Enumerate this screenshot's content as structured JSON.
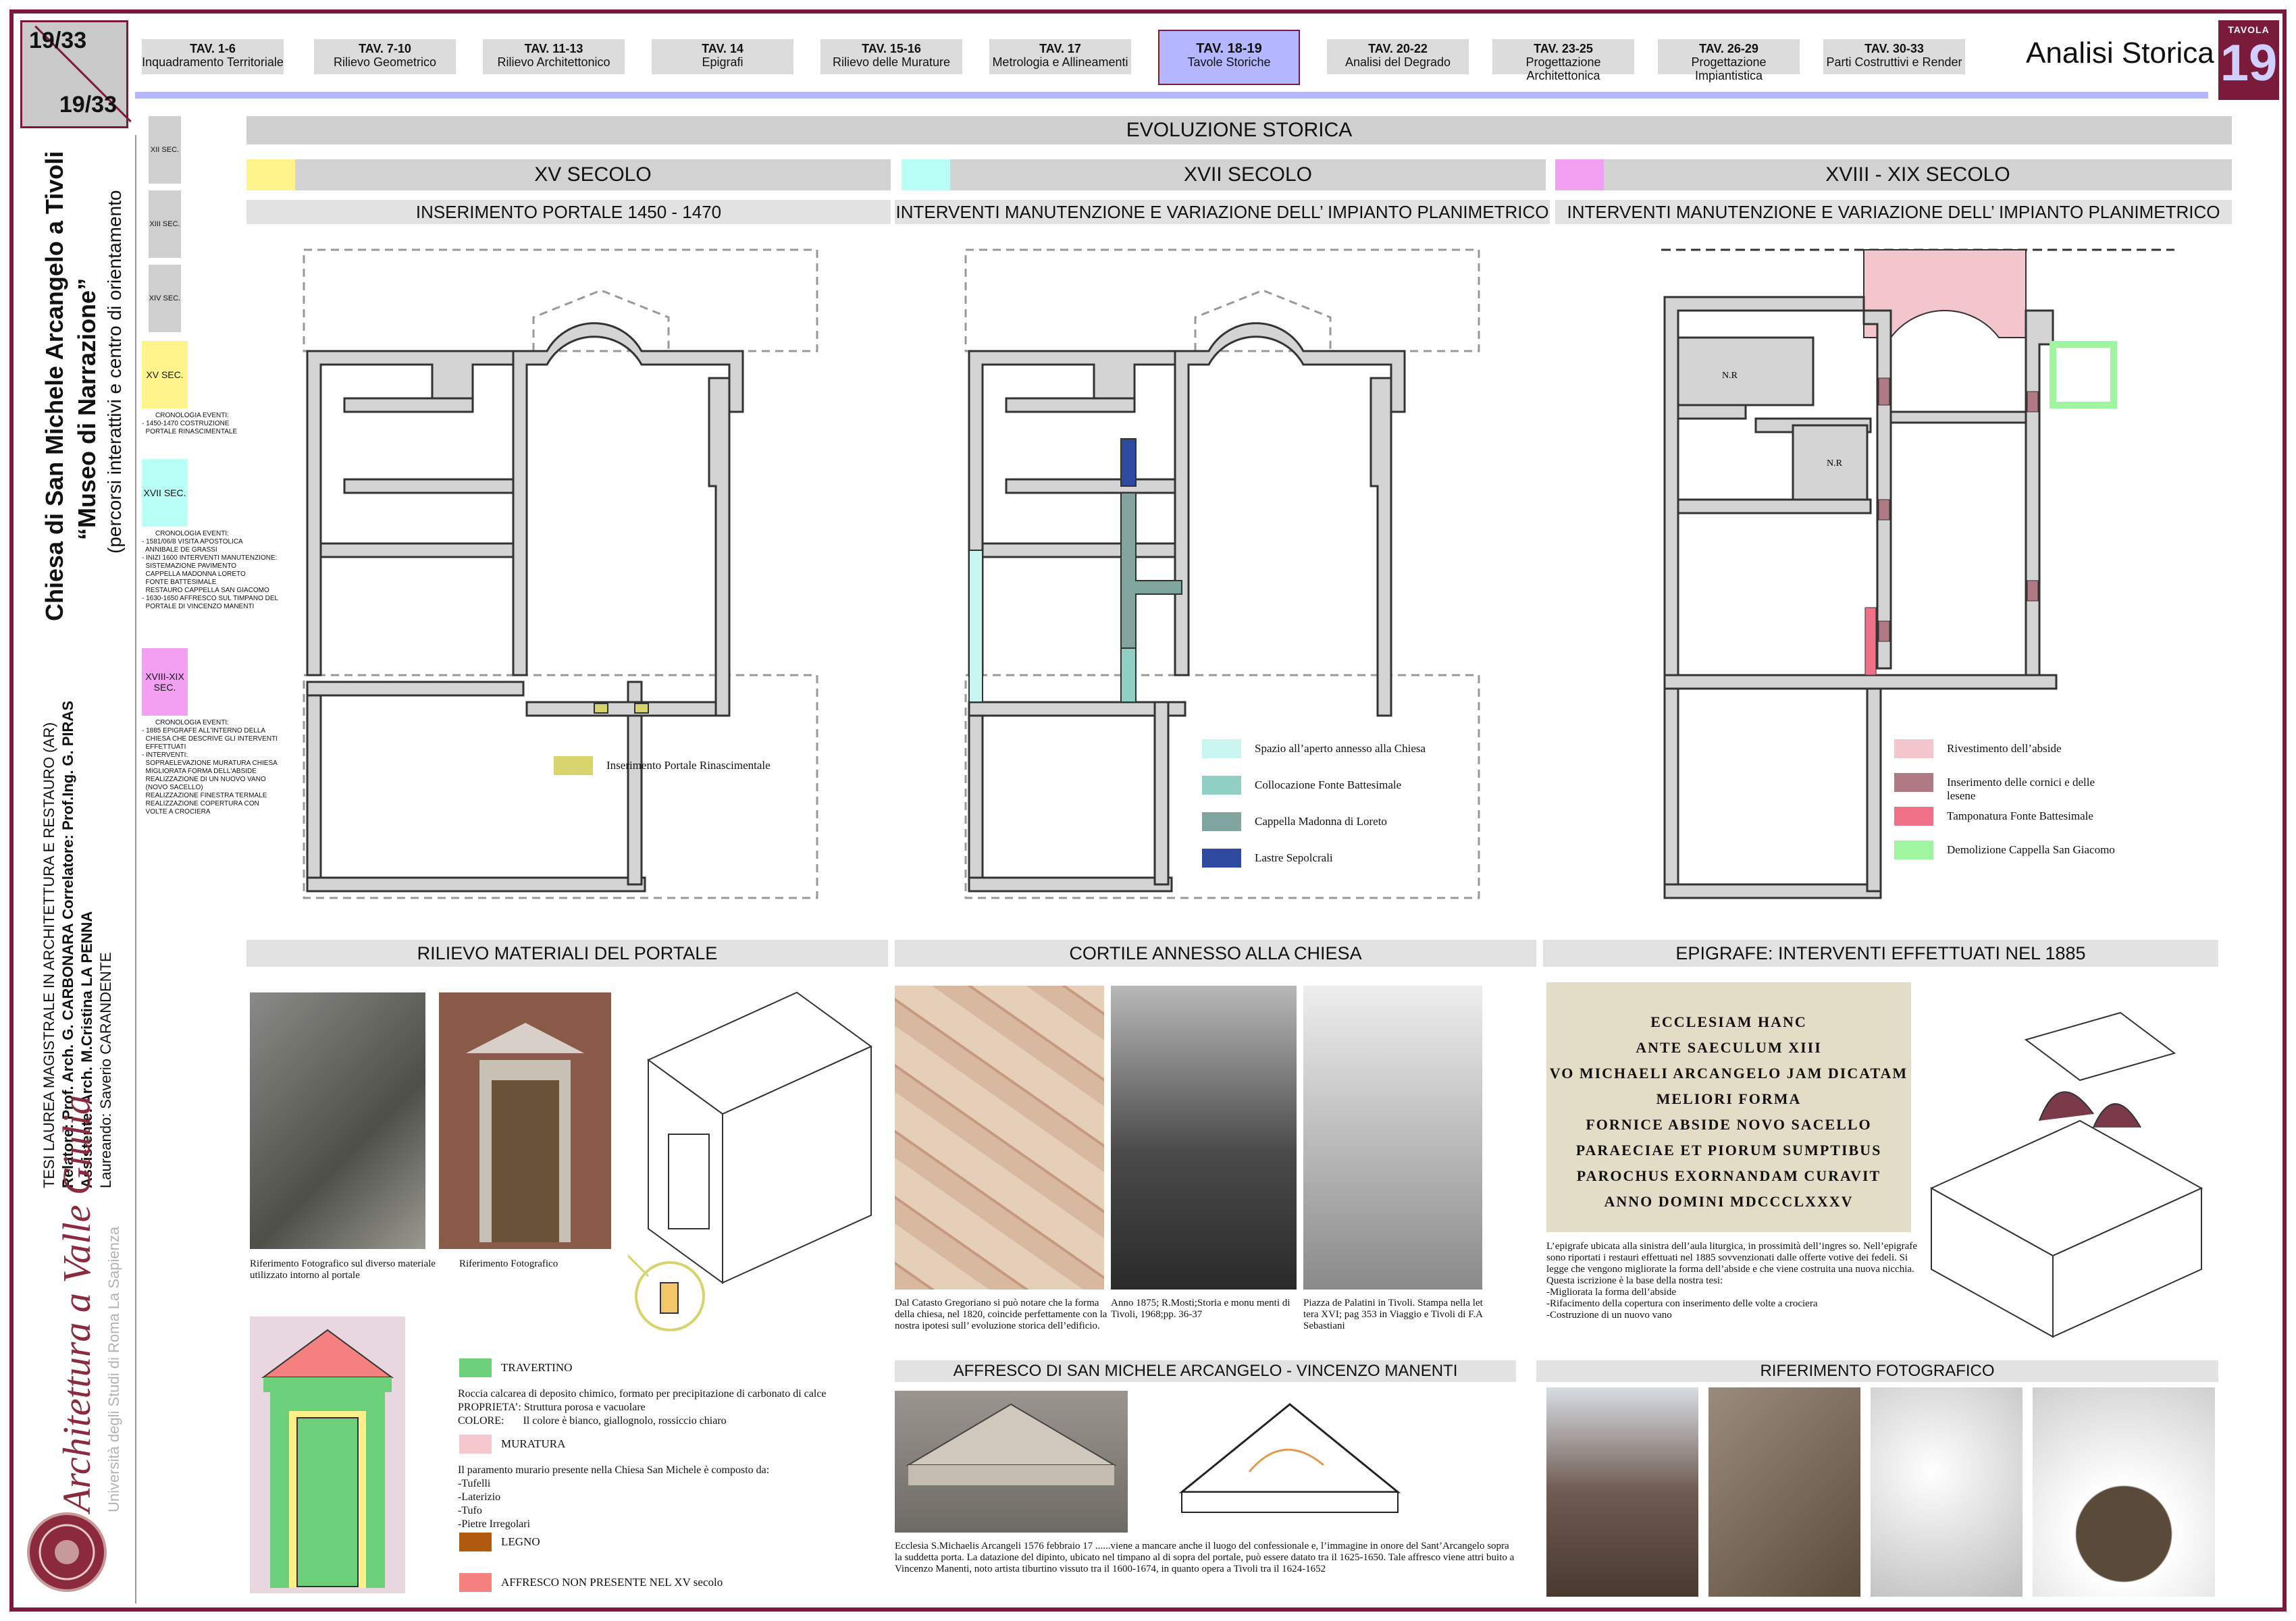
{
  "page_counter": {
    "top": "19",
    "top_total": "33",
    "bottom": "19",
    "bottom_total": "33"
  },
  "nav": {
    "tabs": [
      {
        "num": "TAV. 1-6",
        "label": "Inquadramento Territoriale"
      },
      {
        "num": "TAV. 7-10",
        "label": "Rilievo Geometrico"
      },
      {
        "num": "TAV. 11-13",
        "label": "Rilievo Architettonico"
      },
      {
        "num": "TAV. 14",
        "label": "Epigrafi"
      },
      {
        "num": "TAV. 15-16",
        "label": "Rilievo delle Murature"
      },
      {
        "num": "TAV. 17",
        "label": "Metrologia e Allineamenti"
      },
      {
        "num": "TAV. 18-19",
        "label": "Tavole Storiche",
        "active": true
      },
      {
        "num": "TAV. 20-22",
        "label": "Analisi del Degrado"
      },
      {
        "num": "TAV. 23-25",
        "label": "Progettazione Architettonica"
      },
      {
        "num": "TAV. 26-29",
        "label": "Progettazione Impiantistica"
      },
      {
        "num": "TAV. 30-33",
        "label": "Parti Costruttivi e Render"
      }
    ],
    "section_name": "Analisi Storica",
    "tavola_label": "TAVOLA",
    "tavola_number": "19"
  },
  "sidebar": {
    "title_line1": "Chiesa di San Michele Arcangelo a Tivoli",
    "title_line2": "“Museo di Narrazione”",
    "title_line3": "(percorsi interattivi e centro di orientamento",
    "thesis": "TESI LAUREA MAGISTRALE IN ARCHITETTURA E RESTAURO (AR)",
    "relatore": "Relatore: Prof. Arch. G. CARBONARA  Correlatore: Prof.Ing. G. PIRAS",
    "assistente": "Assistente: Arch. M.Cristina LA PENNA",
    "laureando": "Laureando: Saverio CARANDENTE",
    "logo_text": "Architettura a Valle Giulia",
    "university": "Università degli Studi di Roma La Sapienza",
    "seal_text": "SIBRA STUDIVM"
  },
  "timeline": {
    "centuries_grey": [
      "XII SEC.",
      "XIII SEC.",
      "XIV SEC."
    ],
    "colored": [
      {
        "label": "XV SEC.",
        "color": "#fff48c",
        "note_title": "CRONOLOGIA EVENTI:",
        "notes": [
          "- 1450-1470 COSTRUZIONE",
          "  PORTALE RINASCIMENTALE"
        ]
      },
      {
        "label": "XVII SEC.",
        "color": "#b8fff5",
        "note_title": "CRONOLOGIA EVENTI:",
        "notes": [
          "- 1581/06/8 VISITA APOSTOLICA",
          "  ANNIBALE DE GRASSI",
          "- INIZI 1600 INTERVENTI MANUTENZIONE:",
          "  SISTEMAZIONE PAVIMENTO",
          "  CAPPELLA MADONNA LORETO",
          "  FONTE BATTESIMALE",
          "  RESTAURO CAPPELLA SAN GIACOMO",
          "- 1630-1650 AFFRESCO SUL TIMPANO DEL",
          "  PORTALE DI VINCENZO MANENTI"
        ]
      },
      {
        "label": "XVIII-XIX SEC.",
        "color": "#f2a0f2",
        "note_title": "CRONOLOGIA EVENTI:",
        "notes": [
          "- 1885 EPIGRAFE ALL'INTERNO DELLA",
          "  CHIESA CHE DESCRIVE GLI INTERVENTI",
          "  EFFETTUATI",
          "- INTERVENTI:",
          "  SOPRAELEVAZIONE MURATURA CHIESA",
          "  MIGLIORATA FORMA DELL'ABSIDE",
          "  REALIZZAZIONE DI UN NUOVO VANO",
          "  (NOVO SACELLO)",
          "  REALIZZAZIONE FINESTRA TERMALE",
          "  REALIZZAZIONE COPERTURA CON",
          "  VOLTE A CROCIERA"
        ]
      }
    ]
  },
  "evolution": {
    "title": "EVOLUZIONE STORICA",
    "columns": [
      {
        "century": "XV SECOLO",
        "color": "#fff48c",
        "subtitle": "INSERIMENTO PORTALE 1450 - 1470",
        "legend": [
          {
            "label": "Inserimento Portale Rinascimentale",
            "color": "#d6d46a"
          }
        ]
      },
      {
        "century": "XVII SECOLO",
        "color": "#b8fff5",
        "subtitle": "INTERVENTI MANUTENZIONE E VARIAZIONE DELL’ IMPIANTO PLANIMETRICO",
        "legend": [
          {
            "label": "Spazio all’aperto annesso alla Chiesa",
            "color": "#c8f5ef"
          },
          {
            "label": "Collocazione Fonte Battesimale",
            "color": "#8fcfc4"
          },
          {
            "label": "Cappella Madonna di Loreto",
            "color": "#7fa59e"
          },
          {
            "label": "Lastre Sepolcrali",
            "color": "#2d4aa0"
          }
        ]
      },
      {
        "century": "XVIII - XIX SECOLO",
        "color": "#f2a0f2",
        "subtitle": "INTERVENTI MANUTENZIONE E VARIAZIONE DELL’ IMPIANTO PLANIMETRICO",
        "legend": [
          {
            "label": "Rivestimento dell’abside",
            "color": "#f2c6cc"
          },
          {
            "label": "Inserimento delle cornici e delle lesene",
            "color": "#b07a85"
          },
          {
            "label": "Tamponatura Fonte Battesimale",
            "color": "#f07088"
          },
          {
            "label": "Demolizione Cappella San Giacomo",
            "color": "#a0f5a0"
          }
        ]
      }
    ],
    "plan_labels": [
      "N.R",
      "N.R"
    ]
  },
  "portale": {
    "title": "RILIEVO MATERIALI DEL PORTALE",
    "caption1": "Riferimento Fotografico sul diverso materiale utilizzato intorno al portale",
    "caption2": "Riferimento Fotografico",
    "materials": [
      {
        "name": "TRAVERTINO",
        "color": "#6cd07a",
        "desc": [
          "Roccia calcarea di deposito chimico, formato per precipitazione di carbonato di calce",
          "PROPRIETA’: Struttura porosa e vacuolare",
          "COLORE:       Il colore è bianco, giallognolo, rossiccio chiaro"
        ]
      },
      {
        "name": "MURATURA",
        "color": "#f5c8d0",
        "desc": [
          "Il paramento murario presente nella Chiesa San Michele è composto da:",
          "-Tufelli",
          "-Laterizio",
          "-Tufo",
          "-Pietre Irregolari"
        ]
      },
      {
        "name": "LEGNO",
        "color": "#b05a10",
        "desc": []
      },
      {
        "name": "AFFRESCO NON PRESENTE NEL XV secolo",
        "color": "#f58080",
        "desc": []
      }
    ]
  },
  "cortile": {
    "title": "CORTILE ANNESSO ALLA CHIESA",
    "caption1": "Dal Catasto Gregoriano si può notare che la forma della chiesa, nel 1820, coincide perfettamente con la nostra ipotesi sull’ evoluzione storica dell’edificio.",
    "caption2": "Anno 1875; R.Mosti;Storia e monu menti di Tivoli, 1968;pp. 36-37",
    "caption3": "Piazza de Palatini in Tivoli. Stampa nella let tera XVI; pag 353 in Viaggio e Tivoli di F.A Sebastiani"
  },
  "affresco": {
    "title": "AFFRESCO DI SAN MICHELE ARCANGELO - VINCENZO MANENTI",
    "caption": "Ecclesia S.Michaelis Arcangeli 1576 febbraio 17 ......viene a mancare anche il luogo del confessionale e, l’immagine in onore del Sant’Arcangelo sopra la suddetta porta. La datazione del dipinto, ubicato nel timpano al di sopra del portale, può essere datato tra il 1625-1650. Tale affresco viene attri buito a Vincenzo Manenti, noto artista tiburtino vissuto tra il 1600-1674, in quanto opera a Tivoli tra il 1624-1652"
  },
  "epigrafe": {
    "title": "EPIGRAFE: INTERVENTI EFFETTUATI NEL 1885",
    "inscription": [
      "ECCLESIAM HANC",
      "ANTE SAECULUM XIII",
      "VO MICHAELI ARCANGELO JAM DICATAM",
      "MELIORI FORMA",
      "FORNICE ABSIDE NOVO SACELLO",
      "PARAECIAE ET PIORUM SUMPTIBUS",
      "PAROCHUS EXORNANDAM CURAVIT",
      "ANNO DOMINI MDCCCLXXXV"
    ],
    "caption": [
      "L’epigrafe ubicata alla sinistra dell’aula liturgica, in prossimità dell’ingres so. Nell’epigrafe sono riportati i restauri effettuati nel 1885 sovvenzionati dalle offerte votive dei fedeli. Si legge che vengono migliorate la forma dell’abside e che viene costruita una nuova nicchia. Questa iscrizione è la base della nostra tesi:",
      "-Migliorata la forma dell’abside",
      "-Rifacimento della copertura con inserimento delle volte a crociera",
      "-Costruzione di un nuovo vano"
    ]
  },
  "riferimento": {
    "title": "RIFERIMENTO FOTOGRAFICO"
  }
}
